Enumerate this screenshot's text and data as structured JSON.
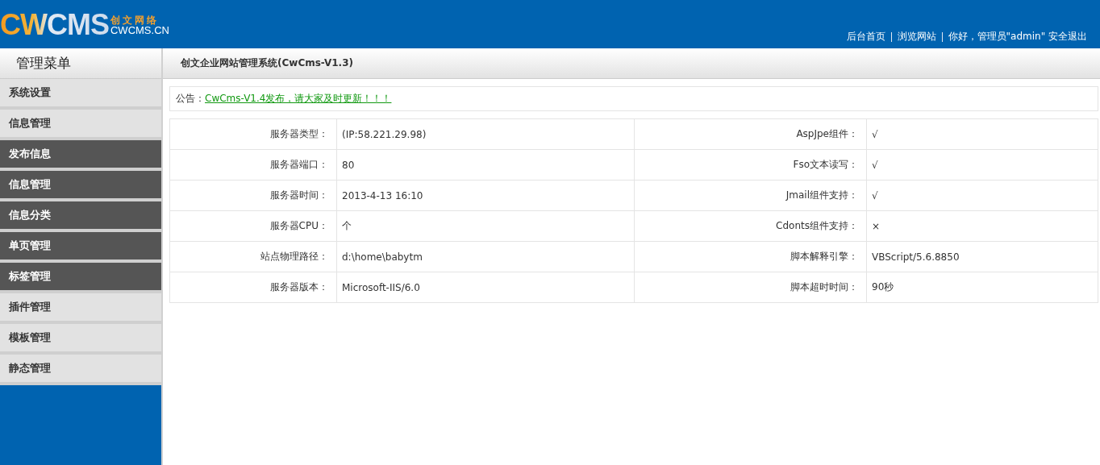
{
  "logo": {
    "mark": "CWCMS",
    "cn": "创文网络",
    "domain": "CWCMS.CN"
  },
  "top_nav": [
    {
      "label": "后台首页"
    },
    {
      "label": "浏览网站"
    },
    {
      "label": "你好，管理员\"admin\" 安全退出"
    }
  ],
  "sidebar": {
    "title": "管理菜单",
    "items": [
      {
        "label": "系统设置",
        "kind": "group"
      },
      {
        "label": "信息管理",
        "kind": "group"
      },
      {
        "label": "发布信息",
        "kind": "item"
      },
      {
        "label": "信息管理",
        "kind": "item"
      },
      {
        "label": "信息分类",
        "kind": "item"
      },
      {
        "label": "单页管理",
        "kind": "item"
      },
      {
        "label": "标签管理",
        "kind": "item"
      },
      {
        "label": "插件管理",
        "kind": "group"
      },
      {
        "label": "模板管理",
        "kind": "group"
      },
      {
        "label": "静态管理",
        "kind": "group"
      }
    ]
  },
  "main": {
    "title": "创文企业网站管理系统(CwCms-V1.3)",
    "notice": {
      "label": "公告：",
      "link": "CwCms-V1.4发布，请大家及时更新！！！"
    },
    "rows": [
      [
        "服务器类型：",
        "(IP:58.221.29.98)",
        "AspJpe组件：",
        "√"
      ],
      [
        "服务器端口：",
        "80",
        "Fso文本读写：",
        "√"
      ],
      [
        "服务器时间：",
        "2013-4-13 16:10",
        "Jmail组件支持：",
        "√"
      ],
      [
        "服务器CPU：",
        "个",
        "Cdonts组件支持：",
        "×"
      ],
      [
        "站点物理路径：",
        "d:\\home\\babytm",
        "脚本解释引擎：",
        "VBScript/5.6.8850"
      ],
      [
        "服务器版本：",
        "Microsoft-IIS/6.0",
        "脚本超时时间：",
        "90秒"
      ]
    ]
  }
}
